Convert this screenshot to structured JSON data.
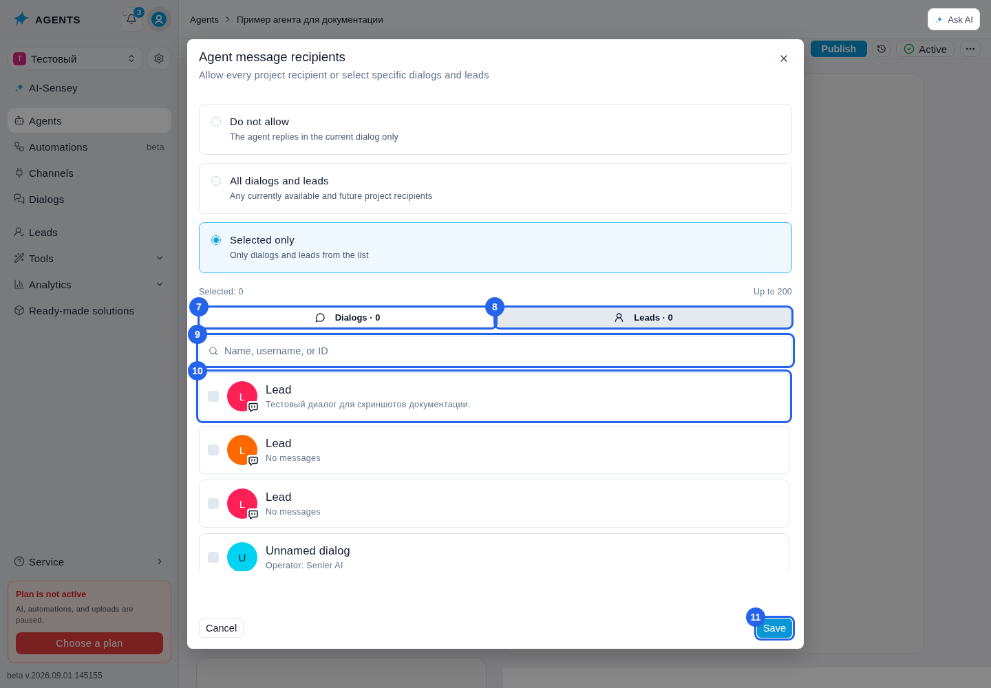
{
  "sidebar": {
    "logo": "AGENTS",
    "notifications": {
      "count": "3"
    },
    "project": {
      "initial": "T",
      "name": "Тестовый"
    },
    "ai_link": "AI-Sensey",
    "nav_sections": [
      {
        "items": [
          {
            "label": "Agents",
            "selected": true
          },
          {
            "label": "Automations",
            "badge": "beta",
            "selected": false
          },
          {
            "label": "Channels",
            "selected": false
          },
          {
            "label": "Dialogs",
            "selected": false
          }
        ]
      },
      {
        "items": [
          {
            "label": "Leads",
            "selected": false
          },
          {
            "label": "Tools",
            "expanded": false,
            "selected": false
          },
          {
            "label": "Analytics",
            "expanded": false,
            "selected": false
          },
          {
            "label": "Ready-made solutions",
            "selected": false
          }
        ]
      }
    ],
    "service": "Service",
    "plan_alert": {
      "title": "Plan is not active",
      "text": "AI, automations, and uploads are paused.",
      "button": "Choose a plan"
    },
    "version": "beta v.2026.09.01.145155"
  },
  "header": {
    "breadcrumb": [
      "Agents",
      "Пример агента для документации"
    ],
    "ask_ai": "Ask AI"
  },
  "toolbar": {
    "publish": "Publish",
    "status": "Active"
  },
  "dialog": {
    "title": "Agent message recipients",
    "subtitle": "Allow every project recipient or select specific dialogs and leads",
    "options": [
      {
        "title": "Do not allow",
        "description": "The agent replies in the current dialog only",
        "selected": false
      },
      {
        "title": "All dialogs and leads",
        "description": "Any currently available and future project recipients",
        "selected": false
      },
      {
        "title": "Selected only",
        "description": "Only dialogs and leads from the list",
        "selected": true
      }
    ],
    "selected_count": "Selected: 0",
    "limit": "Up to 200",
    "tabs": [
      {
        "label": "Dialogs · 0",
        "selected": true,
        "annotation": "7"
      },
      {
        "label": "Leads · 0",
        "selected": false,
        "annotation": "8"
      }
    ],
    "search": {
      "placeholder": "Name, username, or ID",
      "annotation": "9"
    },
    "items": [
      {
        "initial": "L",
        "name": "Lead",
        "preview": "Тестовый диалог для скриншотов документации.",
        "color": "#ff2056",
        "chat_badge": true,
        "checked": false,
        "annotation": "10"
      },
      {
        "initial": "L",
        "name": "Lead",
        "preview": "No messages",
        "color": "#ff6900",
        "chat_badge": true,
        "checked": false
      },
      {
        "initial": "L",
        "name": "Lead",
        "preview": "No messages",
        "color": "#ff2056",
        "chat_badge": true,
        "checked": false
      },
      {
        "initial": "U",
        "name": "Unnamed dialog",
        "preview": "Operator: Senler AI",
        "color": "#00d3f2",
        "chat_badge": false,
        "checked": false
      }
    ],
    "cancel": "Cancel",
    "save": {
      "label": "Save",
      "annotation": "11"
    }
  }
}
